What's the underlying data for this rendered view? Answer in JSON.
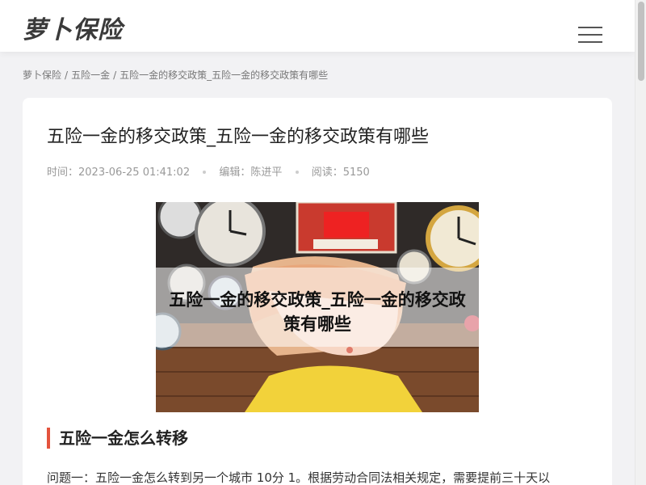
{
  "header": {
    "logo": "萝卜保险",
    "menu_icon": "hamburger-menu-icon"
  },
  "breadcrumb": {
    "items": [
      "萝卜保险",
      "五险一金",
      "五险一金的移交政策_五险一金的移交政策有哪些"
    ],
    "separator": "/"
  },
  "article": {
    "title": "五险一金的移交政策_五险一金的移交政策有哪些",
    "meta": {
      "time_label": "时间：",
      "time": "2023-06-25 01:41:02",
      "editor_label": "编辑：",
      "editor": "陈进平",
      "reads_label": "阅读：",
      "reads": "5150"
    },
    "hero": {
      "caption": "五险一金的移交政策_五险一金的移交政策有哪些"
    },
    "section_heading": "五险一金怎么转移",
    "paragraph": "问题一：五险一金怎么转到另一个城市 10分 1。根据劳动合同法相关规定，需要提前三十天以"
  },
  "colors": {
    "accent": "#e4533d",
    "page_bg": "#f2f2f4",
    "card_bg": "#ffffff"
  }
}
